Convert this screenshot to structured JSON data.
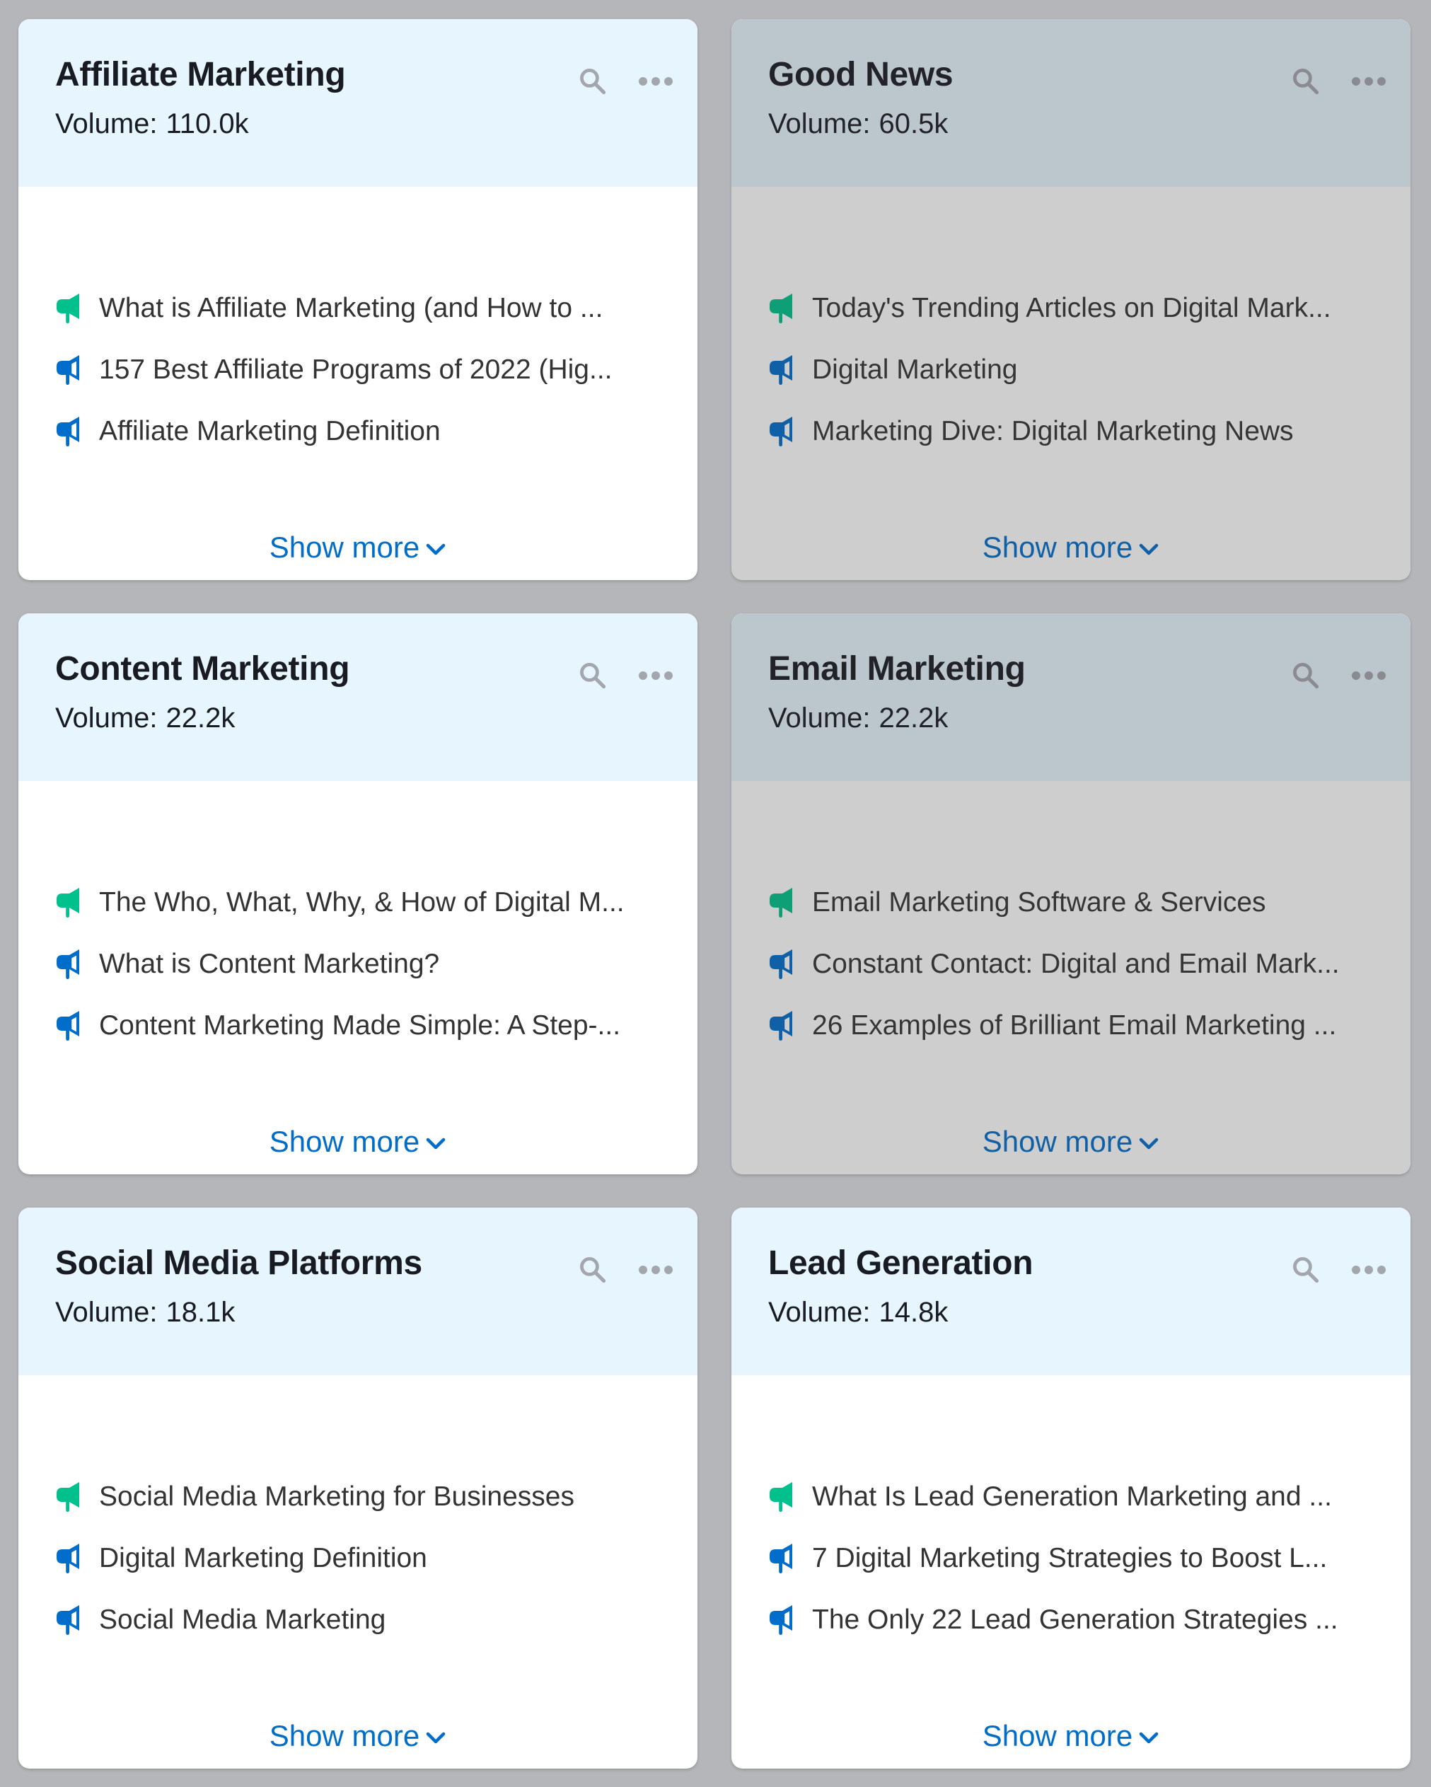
{
  "colors": {
    "background": "#b5b6ba",
    "header_bg": "#e7f6fe",
    "card_bg": "#ffffff",
    "title": "#191b23",
    "link": "#006dca",
    "icon_gray": "#a4a6ae",
    "megaphone_primary": "#00c08b",
    "megaphone_secondary": "#006dca"
  },
  "volume_label": "Volume:",
  "show_more_label": "Show more",
  "cards": [
    {
      "title": "Affiliate Marketing",
      "volume": "110.0k",
      "dimmed": false,
      "results": [
        {
          "text": "What is Affiliate Marketing (and How to ...",
          "icon": "megaphone-filled-icon",
          "type": "primary"
        },
        {
          "text": "157 Best Affiliate Programs of 2022 (Hig...",
          "icon": "megaphone-outline-icon",
          "type": "secondary"
        },
        {
          "text": "Affiliate Marketing Definition",
          "icon": "megaphone-outline-icon",
          "type": "secondary"
        }
      ]
    },
    {
      "title": "Good News",
      "volume": "60.5k",
      "dimmed": true,
      "results": [
        {
          "text": "Today's Trending Articles on Digital Mark...",
          "icon": "megaphone-filled-icon",
          "type": "primary"
        },
        {
          "text": "Digital Marketing",
          "icon": "megaphone-outline-icon",
          "type": "secondary"
        },
        {
          "text": "Marketing Dive: Digital Marketing News",
          "icon": "megaphone-outline-icon",
          "type": "secondary"
        }
      ]
    },
    {
      "title": "Content Marketing",
      "volume": "22.2k",
      "dimmed": false,
      "results": [
        {
          "text": "The Who, What, Why, & How of Digital M...",
          "icon": "megaphone-filled-icon",
          "type": "primary"
        },
        {
          "text": "What is Content Marketing?",
          "icon": "megaphone-outline-icon",
          "type": "secondary"
        },
        {
          "text": "Content Marketing Made Simple: A Step-...",
          "icon": "megaphone-outline-icon",
          "type": "secondary"
        }
      ]
    },
    {
      "title": "Email Marketing",
      "volume": "22.2k",
      "dimmed": true,
      "results": [
        {
          "text": "Email Marketing Software & Services",
          "icon": "megaphone-filled-icon",
          "type": "primary"
        },
        {
          "text": "Constant Contact: Digital and Email Mark...",
          "icon": "megaphone-outline-icon",
          "type": "secondary"
        },
        {
          "text": "26 Examples of Brilliant Email Marketing ...",
          "icon": "megaphone-outline-icon",
          "type": "secondary"
        }
      ]
    },
    {
      "title": "Social Media Platforms",
      "volume": "18.1k",
      "dimmed": false,
      "results": [
        {
          "text": "Social Media Marketing for Businesses",
          "icon": "megaphone-filled-icon",
          "type": "primary"
        },
        {
          "text": "Digital Marketing Definition",
          "icon": "megaphone-outline-icon",
          "type": "secondary"
        },
        {
          "text": "Social Media Marketing",
          "icon": "megaphone-outline-icon",
          "type": "secondary"
        }
      ]
    },
    {
      "title": "Lead Generation",
      "volume": "14.8k",
      "dimmed": false,
      "results": [
        {
          "text": "What Is Lead Generation Marketing and ...",
          "icon": "megaphone-filled-icon",
          "type": "primary"
        },
        {
          "text": "7 Digital Marketing Strategies to Boost L...",
          "icon": "megaphone-outline-icon",
          "type": "secondary"
        },
        {
          "text": "The Only 22 Lead Generation Strategies ...",
          "icon": "megaphone-outline-icon",
          "type": "secondary"
        }
      ]
    }
  ]
}
